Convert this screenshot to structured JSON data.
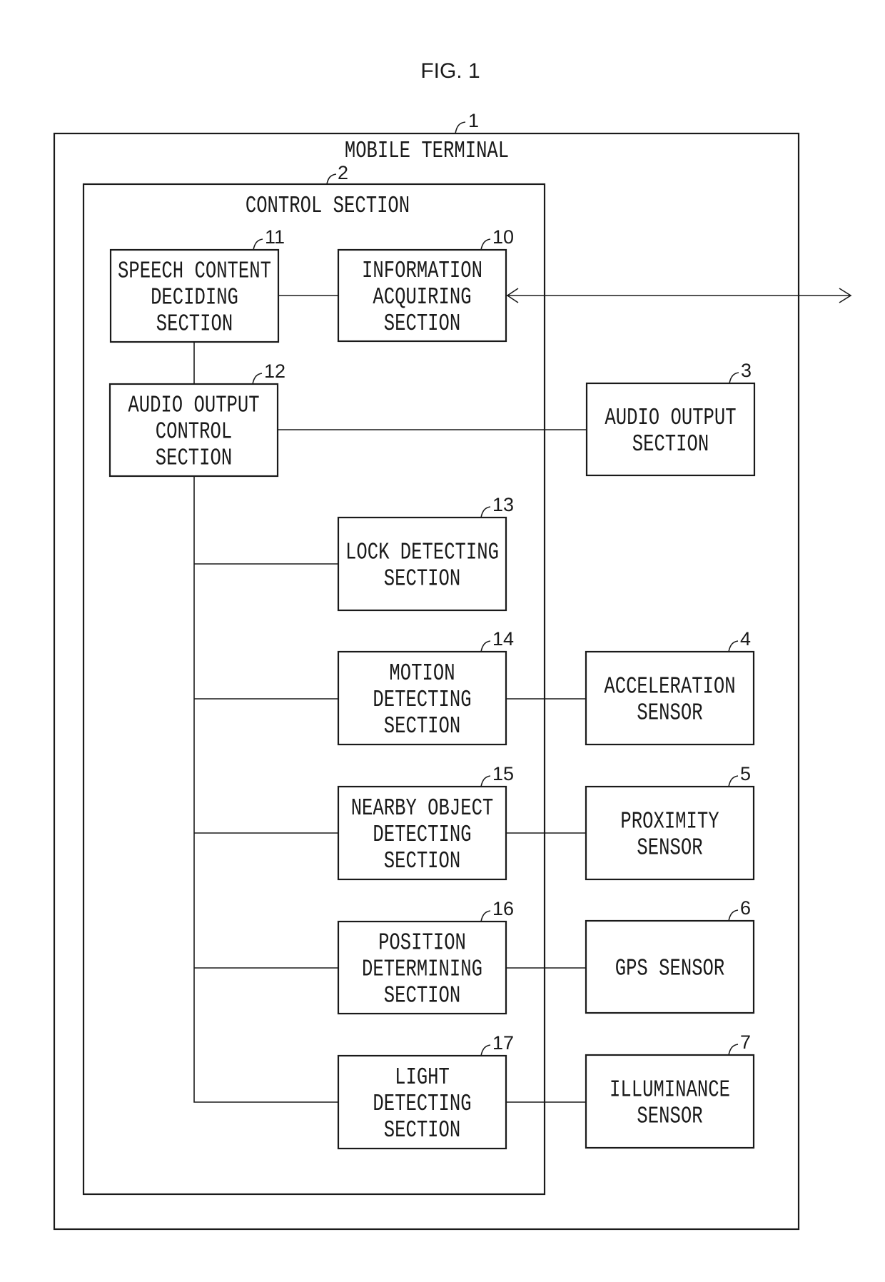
{
  "figure": {
    "title": "FIG. 1"
  },
  "mobile_terminal": {
    "ref": "1",
    "label": "MOBILE TERMINAL"
  },
  "control_section": {
    "ref": "2",
    "label": "CONTROL SECTION"
  },
  "blocks": {
    "speech_content_deciding": {
      "ref": "11",
      "lines": [
        "SPEECH CONTENT",
        "DECIDING",
        "SECTION"
      ]
    },
    "information_acquiring": {
      "ref": "10",
      "lines": [
        "INFORMATION",
        "ACQUIRING",
        "SECTION"
      ]
    },
    "audio_output_control": {
      "ref": "12",
      "lines": [
        "AUDIO OUTPUT",
        "CONTROL",
        "SECTION"
      ]
    },
    "audio_output": {
      "ref": "3",
      "lines": [
        "AUDIO OUTPUT",
        "SECTION"
      ]
    },
    "lock_detecting": {
      "ref": "13",
      "lines": [
        "LOCK DETECTING",
        "SECTION"
      ]
    },
    "motion_detecting": {
      "ref": "14",
      "lines": [
        "MOTION",
        "DETECTING",
        "SECTION"
      ]
    },
    "acceleration_sensor": {
      "ref": "4",
      "lines": [
        "ACCELERATION",
        "SENSOR"
      ]
    },
    "nearby_object_detecting": {
      "ref": "15",
      "lines": [
        "NEARBY OBJECT",
        "DETECTING",
        "SECTION"
      ]
    },
    "proximity_sensor": {
      "ref": "5",
      "lines": [
        "PROXIMITY",
        "SENSOR"
      ]
    },
    "position_determining": {
      "ref": "16",
      "lines": [
        "POSITION",
        "DETERMINING",
        "SECTION"
      ]
    },
    "gps_sensor": {
      "ref": "6",
      "lines": [
        "GPS SENSOR"
      ]
    },
    "light_detecting": {
      "ref": "17",
      "lines": [
        "LIGHT",
        "DETECTING",
        "SECTION"
      ]
    },
    "illuminance_sensor": {
      "ref": "7",
      "lines": [
        "ILLUMINANCE",
        "SENSOR"
      ]
    }
  },
  "connections": [
    {
      "from": "speech_content_deciding",
      "to": "information_acquiring",
      "type": "line"
    },
    {
      "from": "speech_content_deciding",
      "to": "audio_output_control",
      "type": "line"
    },
    {
      "from": "audio_output_control",
      "to": "audio_output",
      "type": "line"
    },
    {
      "from": "audio_output_control",
      "to": "lock_detecting",
      "type": "bus"
    },
    {
      "from": "audio_output_control",
      "to": "motion_detecting",
      "type": "bus"
    },
    {
      "from": "audio_output_control",
      "to": "nearby_object_detecting",
      "type": "bus"
    },
    {
      "from": "audio_output_control",
      "to": "position_determining",
      "type": "bus"
    },
    {
      "from": "audio_output_control",
      "to": "light_detecting",
      "type": "bus"
    },
    {
      "from": "motion_detecting",
      "to": "acceleration_sensor",
      "type": "line"
    },
    {
      "from": "nearby_object_detecting",
      "to": "proximity_sensor",
      "type": "line"
    },
    {
      "from": "position_determining",
      "to": "gps_sensor",
      "type": "line"
    },
    {
      "from": "light_detecting",
      "to": "illuminance_sensor",
      "type": "line"
    },
    {
      "from": "information_acquiring",
      "to": "external",
      "type": "bidirectional-arrow"
    }
  ]
}
